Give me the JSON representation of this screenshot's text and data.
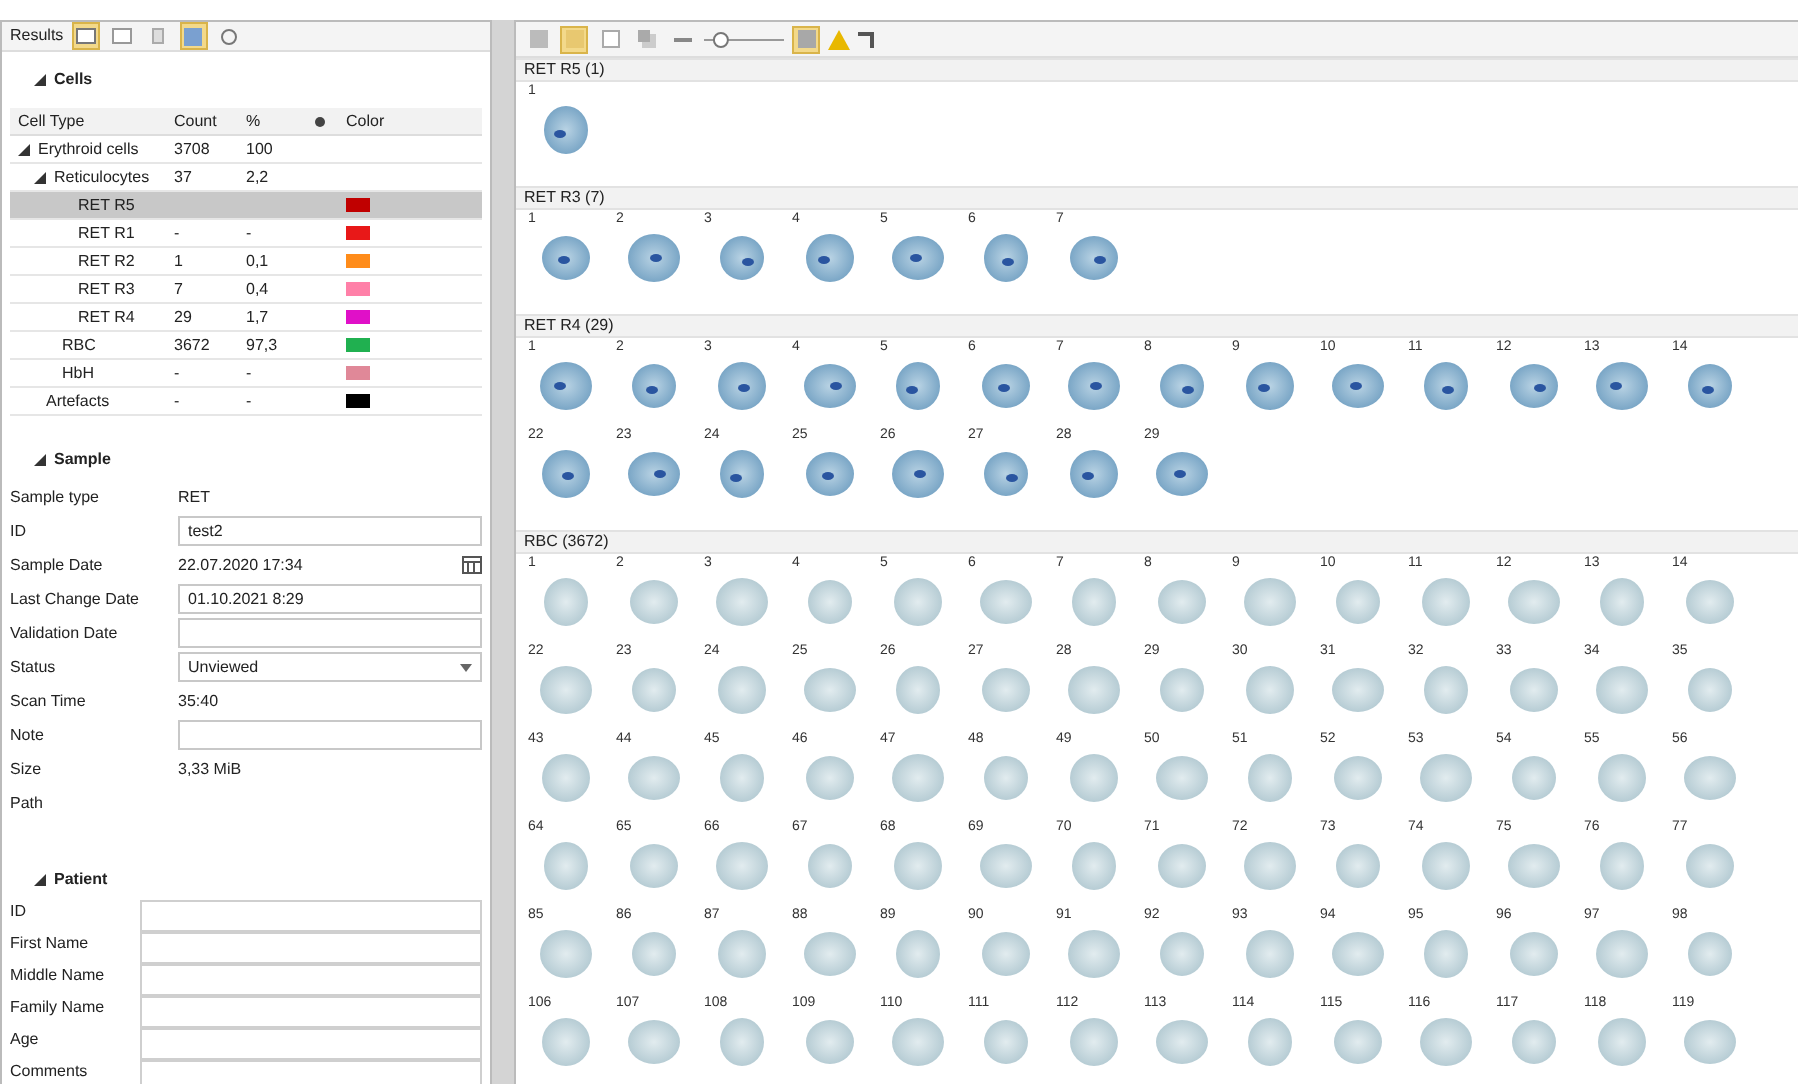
{
  "results_toolbar": {
    "label": "Results"
  },
  "cells": {
    "title": "Cells",
    "expanded": true,
    "columns": [
      "Cell Type",
      "Count",
      "%",
      "Color"
    ],
    "rows": [
      {
        "name": "Erythroid cells",
        "count": "3708",
        "percent": "100",
        "selected": false,
        "expanded": true,
        "children": [
          {
            "name": "Reticulocytes",
            "count": "37",
            "percent": "2,2",
            "selected": false,
            "expanded": true,
            "children": [
              {
                "name": "RET R5",
                "selected": true,
                "color": "#c00000"
              },
              {
                "name": "RET R1",
                "count": "-",
                "percent": "-",
                "selected": false,
                "color": "#e81818"
              },
              {
                "name": "RET R2",
                "count": "1",
                "percent": "0,1",
                "selected": false,
                "color": "#ff8c1a"
              },
              {
                "name": "RET R3",
                "count": "7",
                "percent": "0,4",
                "selected": false,
                "color": "#ff80a8"
              },
              {
                "name": "RET R4",
                "count": "29",
                "percent": "1,7",
                "selected": false,
                "color": "#e010c8"
              }
            ]
          },
          {
            "name": "RBC",
            "count": "3672",
            "percent": "97,3",
            "selected": false,
            "color": "#20b050"
          },
          {
            "name": "HbH",
            "count": "-",
            "percent": "-",
            "selected": false,
            "color": "#e08898"
          }
        ]
      },
      {
        "name": "Artefacts",
        "count": "-",
        "percent": "-",
        "selected": false,
        "color": "#000000"
      }
    ]
  },
  "sample": {
    "title": "Sample",
    "expanded": true,
    "fields": [
      {
        "label": "Sample type",
        "value": "RET",
        "kind": "text"
      },
      {
        "label": "ID",
        "value": "test2",
        "kind": "input"
      },
      {
        "label": "Sample Date",
        "value": "22.07.2020 17:34",
        "kind": "date"
      },
      {
        "label": "Last Change Date",
        "value": "01.10.2021 8:29",
        "kind": "input"
      },
      {
        "label": "Validation Date",
        "kind": "input"
      },
      {
        "label": "Status",
        "value": "Unviewed",
        "kind": "select"
      },
      {
        "label": "Scan Time",
        "value": "35:40",
        "kind": "text"
      },
      {
        "label": "Note",
        "kind": "input"
      },
      {
        "label": "Size",
        "value": "3,33 MiB",
        "kind": "text"
      },
      {
        "label": "Path",
        "kind": "text"
      }
    ]
  },
  "patient": {
    "title": "Patient",
    "expanded": true,
    "fields": [
      {
        "label": "ID"
      },
      {
        "label": "First Name"
      },
      {
        "label": "Middle Name"
      },
      {
        "label": "Family Name"
      },
      {
        "label": "Age"
      },
      {
        "label": "Comments"
      }
    ]
  },
  "zoom_slider": {
    "level": 0.15
  },
  "gallery": [
    {
      "title": "RET R5 (1)",
      "kind": "ret",
      "rows": [
        [
          "1"
        ]
      ]
    },
    {
      "title": "RET R3 (7)",
      "kind": "ret",
      "rows": [
        [
          "1",
          "2",
          "3",
          "4",
          "5",
          "6",
          "7"
        ]
      ]
    },
    {
      "title": "RET R4 (29)",
      "kind": "ret",
      "rows": [
        [
          "1",
          "2",
          "3",
          "4",
          "5",
          "6",
          "7",
          "8",
          "9",
          "10",
          "11",
          "12",
          "13",
          "14"
        ],
        [
          "22",
          "23",
          "24",
          "25",
          "26",
          "27",
          "28",
          "29"
        ]
      ]
    },
    {
      "title": "RBC (3672)",
      "kind": "rbc",
      "rows": [
        [
          "1",
          "2",
          "3",
          "4",
          "5",
          "6",
          "7",
          "8",
          "9",
          "10",
          "11",
          "12",
          "13",
          "14"
        ],
        [
          "22",
          "23",
          "24",
          "25",
          "26",
          "27",
          "28",
          "29",
          "30",
          "31",
          "32",
          "33",
          "34",
          "35"
        ],
        [
          "43",
          "44",
          "45",
          "46",
          "47",
          "48",
          "49",
          "50",
          "51",
          "52",
          "53",
          "54",
          "55",
          "56"
        ],
        [
          "64",
          "65",
          "66",
          "67",
          "68",
          "69",
          "70",
          "71",
          "72",
          "73",
          "74",
          "75",
          "76",
          "77"
        ],
        [
          "85",
          "86",
          "87",
          "88",
          "89",
          "90",
          "91",
          "92",
          "93",
          "94",
          "95",
          "96",
          "97",
          "98"
        ],
        [
          "106",
          "107",
          "108",
          "109",
          "110",
          "111",
          "112",
          "113",
          "114",
          "115",
          "116",
          "117",
          "118",
          "119"
        ]
      ]
    }
  ]
}
